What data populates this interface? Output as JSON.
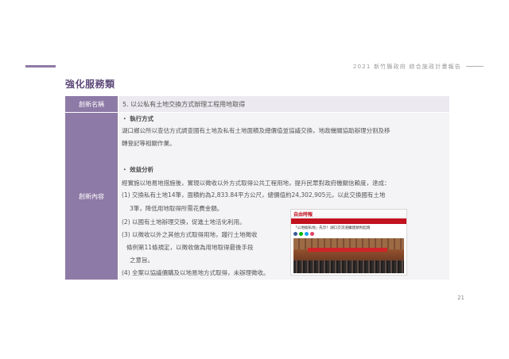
{
  "header": {
    "report_title": "2021 新竹縣政府 綜合施政計畫報告"
  },
  "section_heading": "強化服務類",
  "table": {
    "head_label": "創新名稱",
    "head_value": "5. 以公私有土地交換方式辦理工程用地取得",
    "body_label": "創新內容",
    "block1": {
      "title": "・ 執行方式",
      "lines": [
        "湖口鄉公所以查估方式調查國有土地及私有土地面積及總價值並協議交換，地政機關協助辦理分割及移",
        "轉登記等相關作業。"
      ]
    },
    "block2": {
      "title": "・ 效益分析",
      "lines": [
        "經實施以地易地措施後，實現以徵收以外方式取得公共工程用地，提升民眾對政府機關信賴度，達成：",
        "(1) 交換私有土地14筆，面積約為2,833.84平方公尺，總價值約24,302,905元，以此交換國有土地",
        "3筆，降低用地取得所需花費金額。",
        "(2) 以國有土地辦理交換，促進土地活化利用。",
        "(3) 以徵收以外之其他方式取得用地，踐行土地徵收",
        "條例第11條規定，以徵收做為用地取得最後手段",
        "之意旨。",
        "(4) 全案以協議價購及以地易地方式取得，未辦理徵收。"
      ]
    }
  },
  "news_clip": {
    "logo": "自由時報",
    "headline": "「公地換私地」先示！湖口交流道擴建順利起跑"
  },
  "page_number": "21",
  "colors": {
    "accent_purple": "#8e7aa6",
    "heading_purple": "#5e4a7a",
    "news_red": "#c1121f"
  }
}
